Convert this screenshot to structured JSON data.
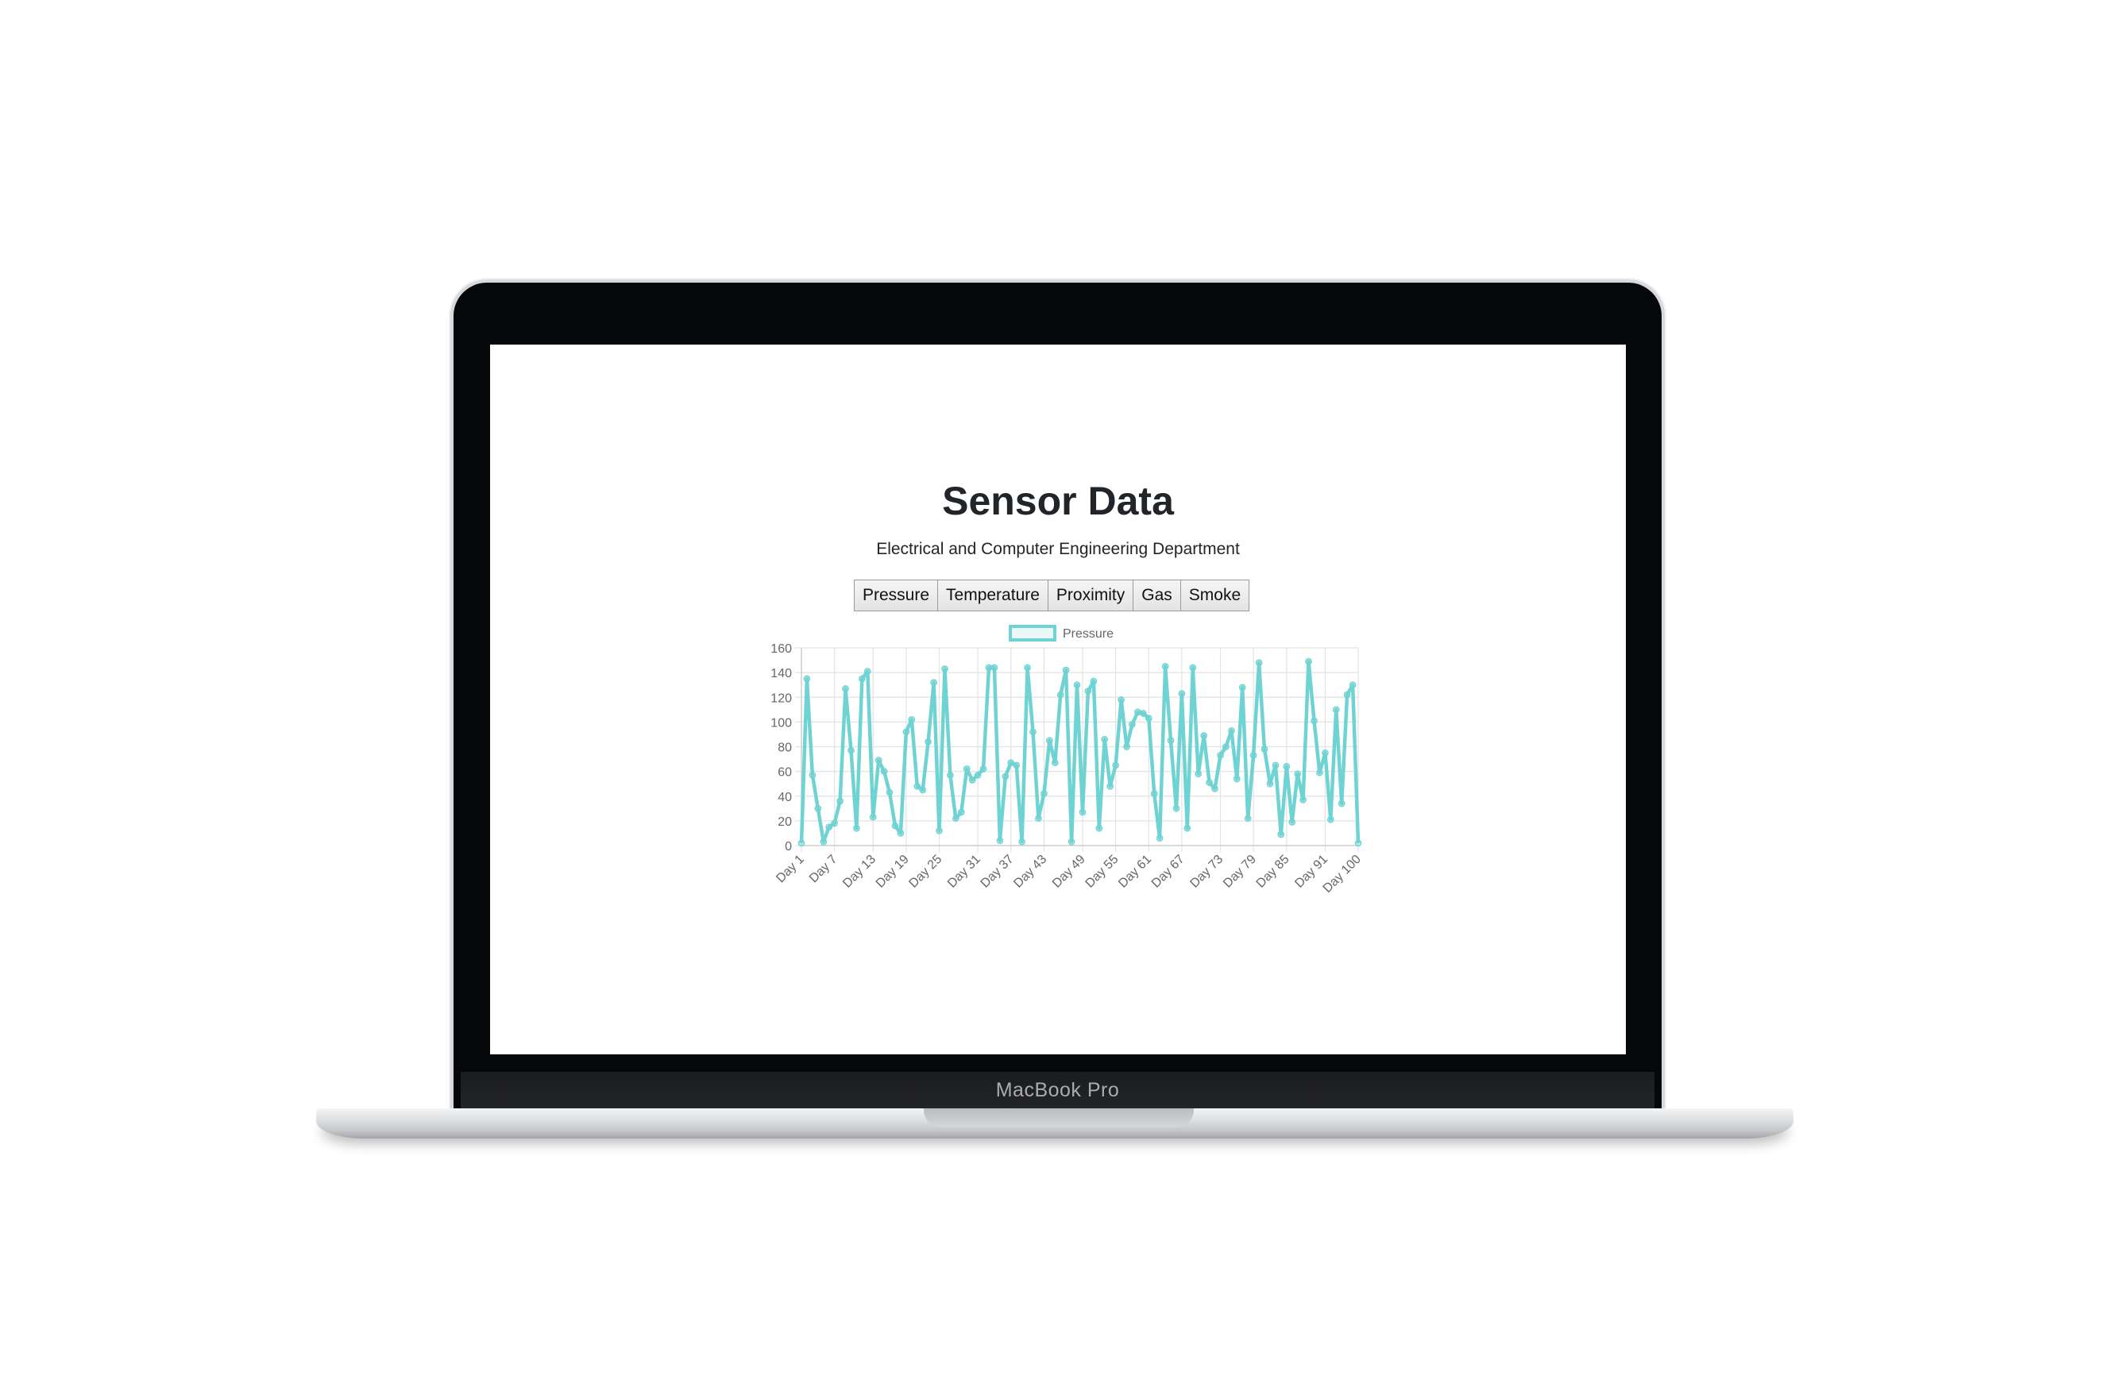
{
  "device": {
    "brand_label": "MacBook Pro"
  },
  "page": {
    "title": "Sensor Data",
    "subtitle": "Electrical and Computer Engineering Department"
  },
  "tabs": [
    {
      "label": "Pressure"
    },
    {
      "label": "Temperature"
    },
    {
      "label": "Proximity"
    },
    {
      "label": "Gas"
    },
    {
      "label": "Smoke"
    }
  ],
  "colors": {
    "series_line": "#6fd3d3",
    "grid": "#e3e3e3",
    "axis_text": "#666666"
  },
  "chart_data": {
    "type": "line",
    "legend_position": "top",
    "grid": true,
    "ylim": [
      0,
      160
    ],
    "yticks": [
      0,
      20,
      40,
      60,
      80,
      100,
      120,
      140,
      160
    ],
    "x_tick_labels": [
      "Day 1",
      "Day 7",
      "Day 13",
      "Day 19",
      "Day 25",
      "Day 31",
      "Day 37",
      "Day 43",
      "Day 49",
      "Day 55",
      "Day 61",
      "Day 67",
      "Day 73",
      "Day 79",
      "Day 85",
      "Day 91",
      "Day 100"
    ],
    "series": [
      {
        "name": "Pressure",
        "values": [
          2,
          135,
          57,
          30,
          3,
          15,
          18,
          36,
          127,
          77,
          14,
          135,
          141,
          23,
          69,
          60,
          43,
          16,
          10,
          92,
          102,
          48,
          45,
          84,
          132,
          12,
          143,
          57,
          22,
          27,
          62,
          53,
          57,
          62,
          144,
          144,
          4,
          56,
          67,
          65,
          3,
          144,
          92,
          22,
          42,
          85,
          67,
          122,
          142,
          3,
          130,
          27,
          125,
          133,
          14,
          86,
          48,
          65,
          118,
          80,
          98,
          108,
          107,
          103,
          42,
          6,
          145,
          85,
          30,
          123,
          14,
          144,
          58,
          89,
          51,
          46,
          73,
          80,
          93,
          54,
          128,
          22,
          73,
          148,
          78,
          50,
          65,
          9,
          64,
          19,
          58,
          37,
          149,
          101,
          59,
          75,
          21,
          110,
          34,
          122,
          130,
          2
        ]
      }
    ]
  }
}
